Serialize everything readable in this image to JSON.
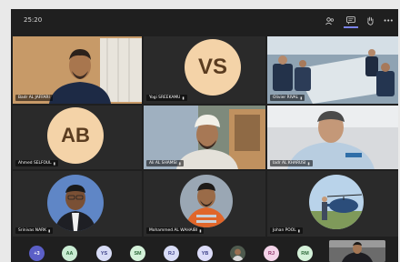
{
  "meeting": {
    "timer": "25:20"
  },
  "toolbar": {
    "icons": [
      "participants-icon",
      "chat-icon",
      "raise-hand-icon",
      "more-options-icon"
    ],
    "more_label": "•••"
  },
  "participants": [
    {
      "name": "Badr AL JAFFARI",
      "type": "video"
    },
    {
      "name": "Yogi SREEKAMU",
      "type": "avatar",
      "initials": "VS",
      "color": "#f4d3a8"
    },
    {
      "name": "Olivier RIVAL",
      "type": "video"
    },
    {
      "name": "Ahmed SELFOUL",
      "type": "avatar",
      "initials": "AB",
      "color": "#f4d3a8"
    },
    {
      "name": "Ali AL SHAMSI",
      "type": "video"
    },
    {
      "name": "Iadr AL KHARUSI",
      "type": "video"
    },
    {
      "name": "Srinivas NARK",
      "type": "photo"
    },
    {
      "name": "Mohammed AL WAHAIBI",
      "type": "photo"
    },
    {
      "name": "Johan POOL",
      "type": "photo"
    }
  ],
  "roster": {
    "overflow": "+3",
    "chips": [
      {
        "initials": "AA",
        "bg": "#c9ecd3",
        "fg": "#2d6b3b"
      },
      {
        "initials": "YS",
        "bg": "#d8dcf6",
        "fg": "#3b3f88"
      },
      {
        "initials": "SM",
        "bg": "#d4f1d9",
        "fg": "#2e6a3a"
      },
      {
        "initials": "RJ",
        "bg": "#d8dcf6",
        "fg": "#3b3f88"
      },
      {
        "initials": "YB",
        "bg": "#dcdcf8",
        "fg": "#3b3f88"
      },
      {
        "initials": "",
        "bg": "#5a5a5a",
        "fg": "#fff"
      },
      {
        "initials": "RJ",
        "bg": "#f3d3e8",
        "fg": "#8a2d62"
      },
      {
        "initials": "RM",
        "bg": "#d4f1d9",
        "fg": "#2e6a3a"
      }
    ]
  }
}
